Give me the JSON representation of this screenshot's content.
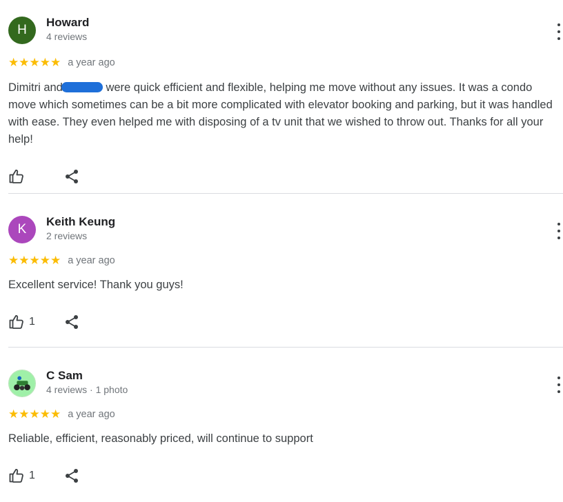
{
  "reviews": [
    {
      "author": "Howard",
      "meta": "4 reviews",
      "avatar_letter": "H",
      "avatar_color": "#33691e",
      "stars": "★★★★★",
      "date": "a year ago",
      "text_before": "Dimitri and",
      "text_after": " were quick efficient and flexible, helping me move without any issues. It was a condo move which sometimes can be a bit more complicated with elevator booking and parking, but it was handled with ease. They even helped me with disposing of a tv unit that we wished to throw out. Thanks for all your help!",
      "likes": ""
    },
    {
      "author": "Keith Keung",
      "meta": "2 reviews",
      "avatar_letter": "K",
      "avatar_color": "#ab47bc",
      "stars": "★★★★★",
      "date": "a year ago",
      "text": "Excellent service! Thank you guys!",
      "likes": "1"
    },
    {
      "author": "C Sam",
      "meta": "4 reviews · 1 photo",
      "stars": "★★★★★",
      "date": "a year ago",
      "text": "Reliable, efficient, reasonably priced, will continue to support",
      "likes": "1"
    }
  ],
  "colors": {
    "star": "#fbbc04",
    "redaction": "#1e6fd9",
    "divider": "#dadce0"
  },
  "icons": {
    "like": "thumb-up-icon",
    "share": "share-icon",
    "more": "more-vert-icon"
  }
}
